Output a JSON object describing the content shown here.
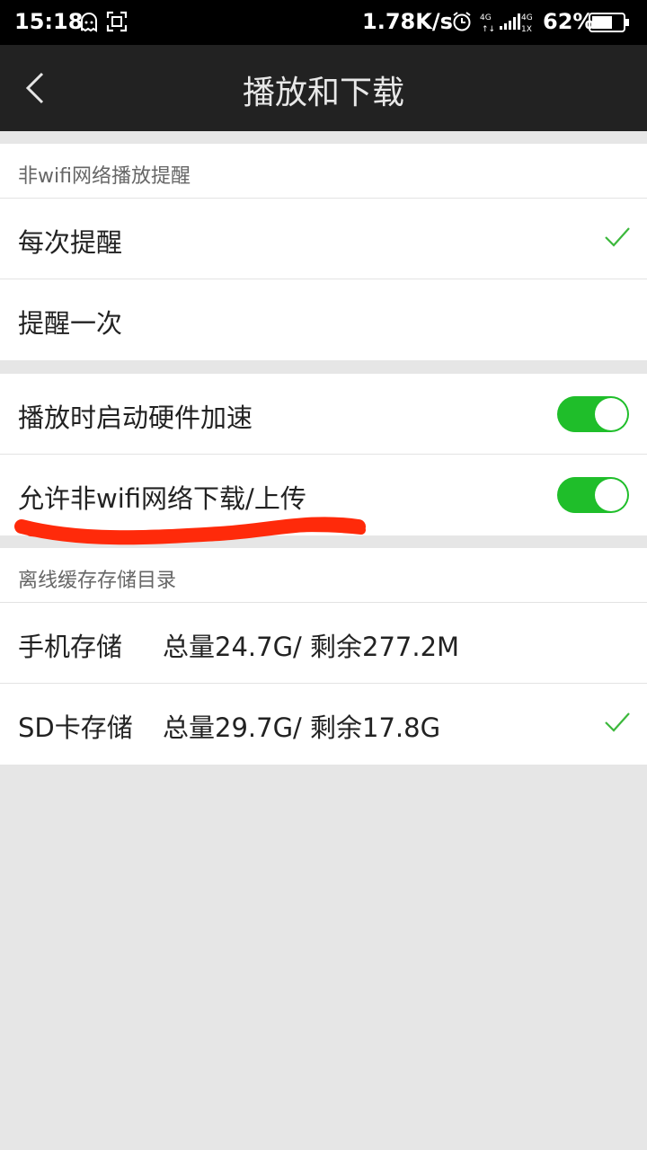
{
  "status_bar": {
    "time": "15:18",
    "speed": "1.78K/s",
    "battery": "62%",
    "icons": [
      "ghost-icon",
      "screenshot-icon",
      "alarm-icon",
      "signal-4g-icon",
      "signal-1x-icon",
      "battery-icon"
    ]
  },
  "header": {
    "title": "播放和下载"
  },
  "wifi_reminder": {
    "section_title": "非wifi网络播放提醒",
    "options": [
      {
        "label": "每次提醒",
        "selected": true
      },
      {
        "label": "提醒一次",
        "selected": false
      }
    ]
  },
  "toggles": [
    {
      "label": "播放时启动硬件加速",
      "on": true
    },
    {
      "label": "允许非wifi网络下载/上传",
      "on": true
    }
  ],
  "cache": {
    "section_title": "离线缓存存储目录",
    "options": [
      {
        "label": "手机存储",
        "info": "总量24.7G/ 剩余277.2M",
        "selected": false
      },
      {
        "label": "SD卡存储",
        "info": "总量29.7G/ 剩余17.8G",
        "selected": true
      }
    ]
  },
  "colors": {
    "accent_green": "#1fbe2a",
    "check_green": "#3cb83c",
    "annotation_red": "#ff2a0a"
  }
}
